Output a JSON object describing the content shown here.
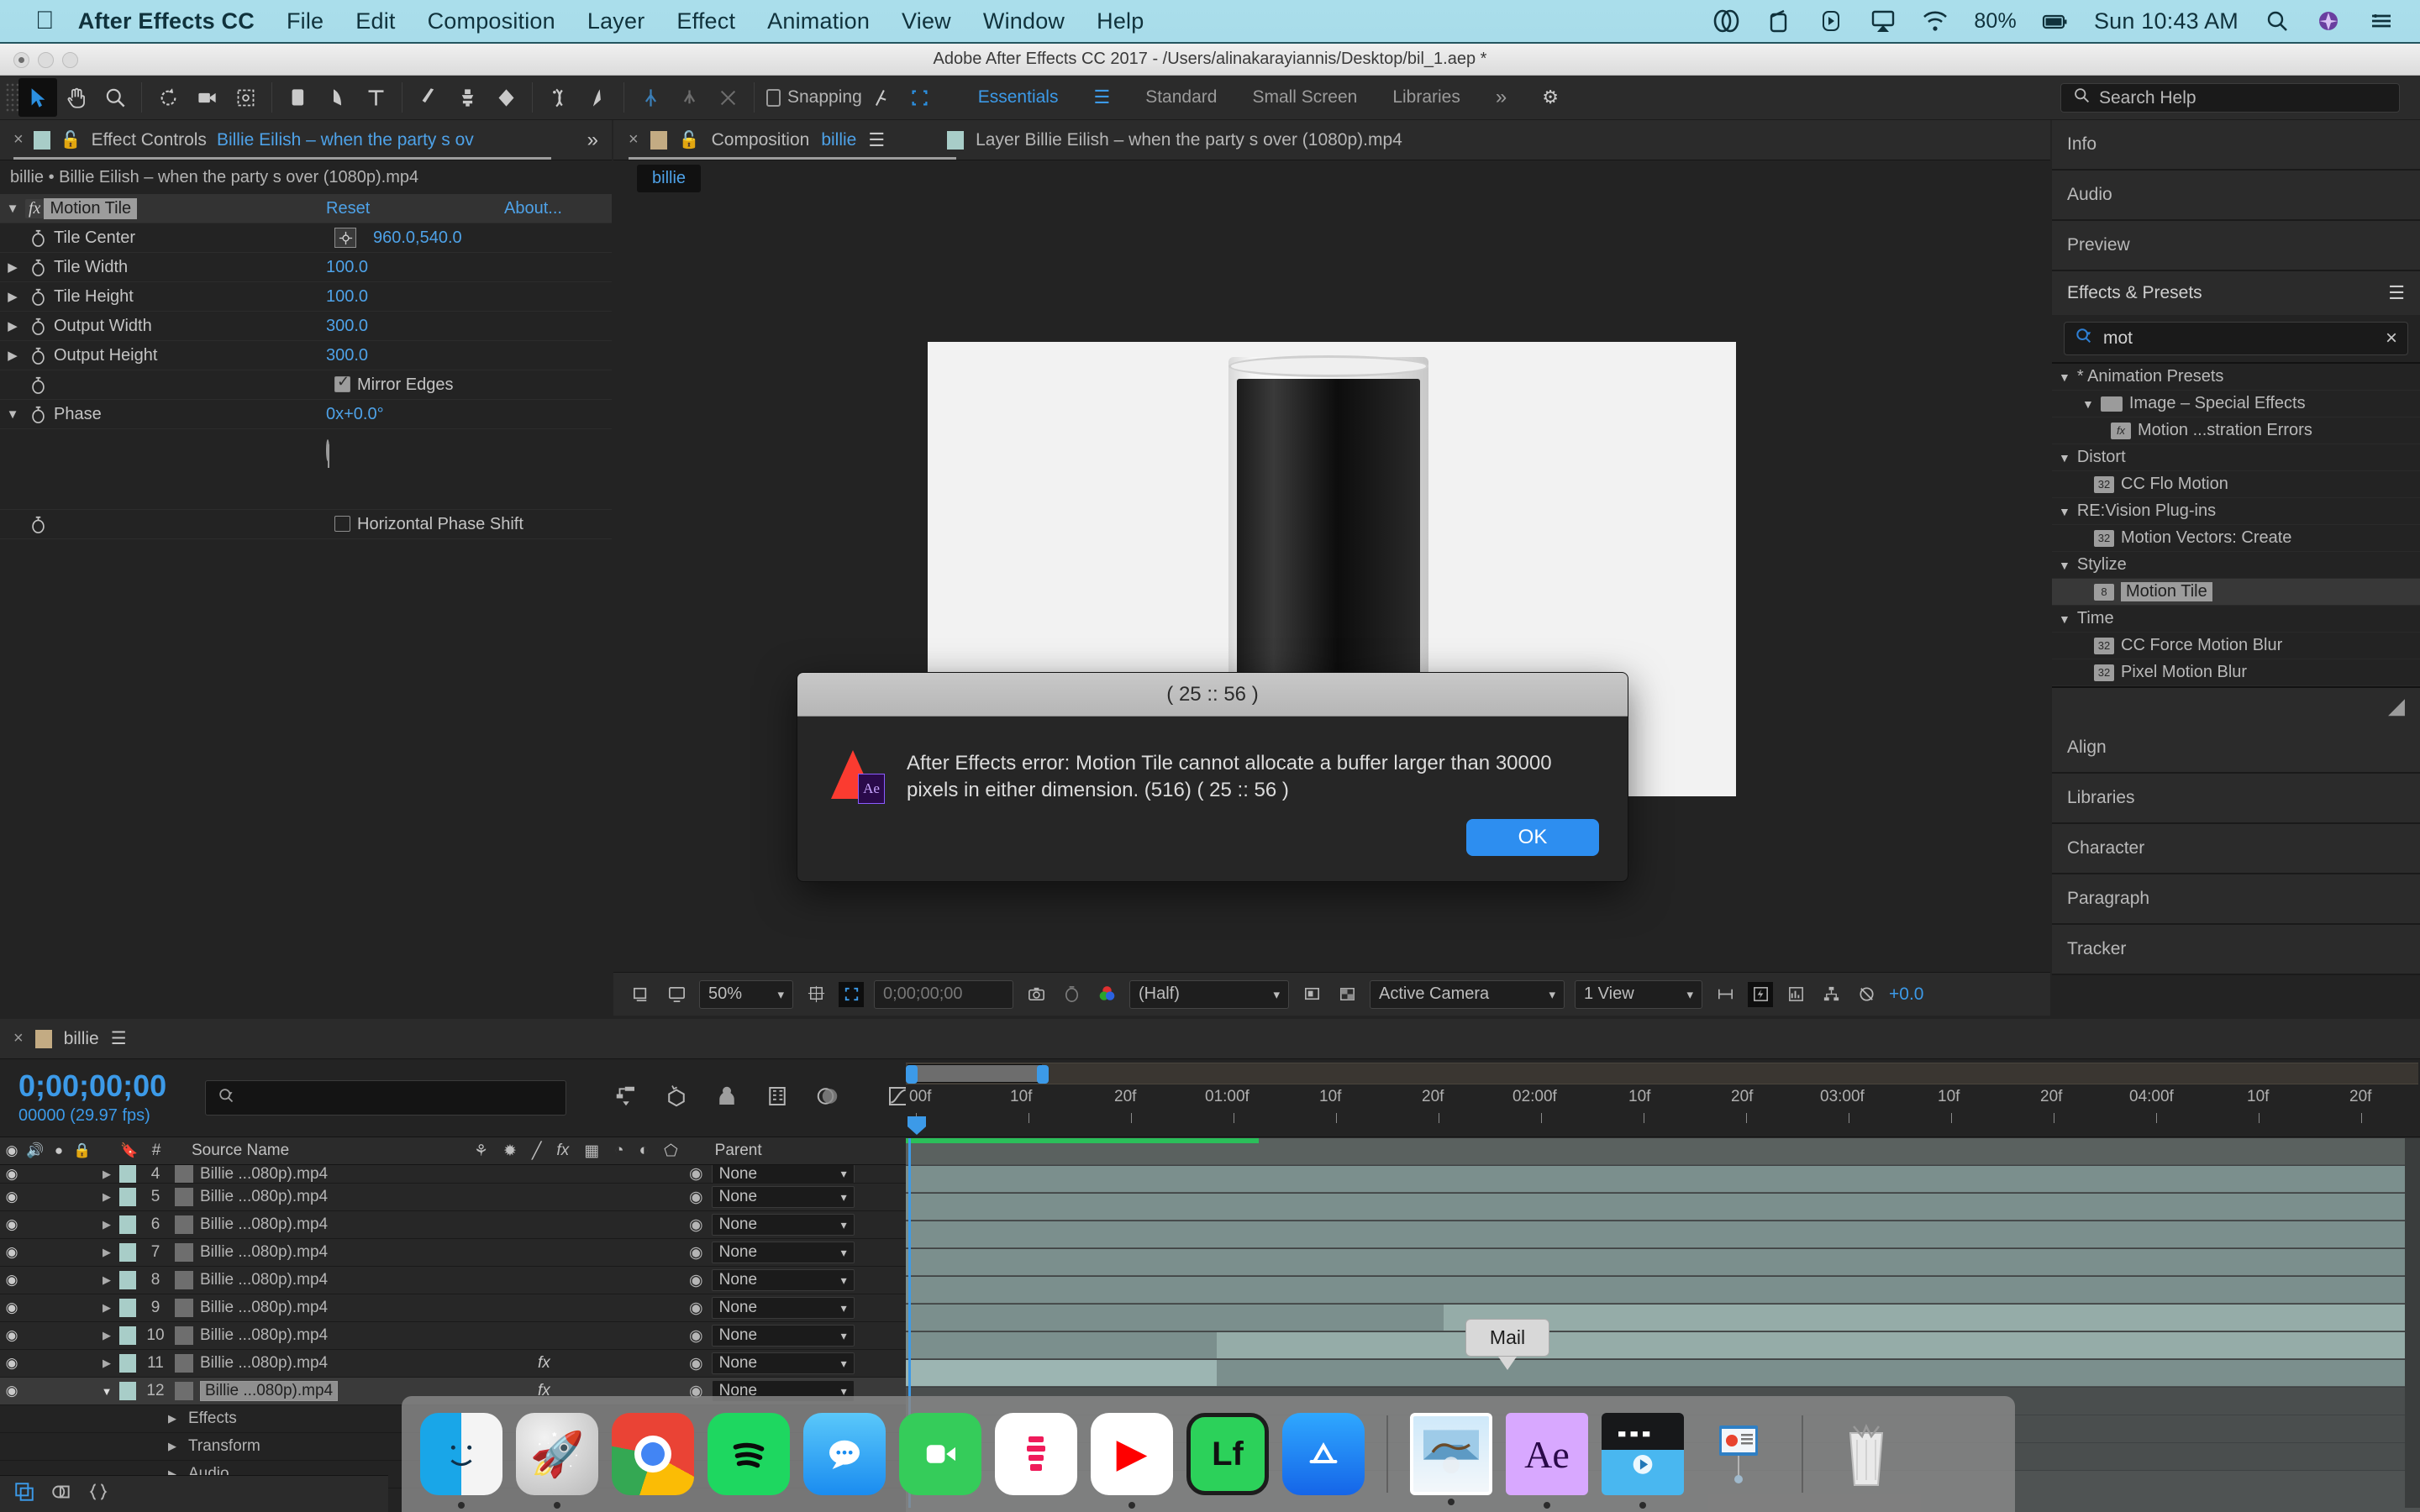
{
  "mac_menu": {
    "apple": "apple-logo",
    "items": [
      "After Effects CC",
      "File",
      "Edit",
      "Composition",
      "Layer",
      "Effect",
      "Animation",
      "View",
      "Window",
      "Help"
    ],
    "status": {
      "battery": "80%",
      "clock": "Sun 10:43 AM",
      "icons": [
        "creative-cloud-icon",
        "screen-record-icon",
        "quicktime-icon",
        "airplay-icon",
        "wifi-icon",
        "battery-icon",
        "spotlight-icon",
        "siri-icon",
        "control-center-icon"
      ]
    }
  },
  "window": {
    "title": "Adobe After Effects CC 2017 - /Users/alinakarayiannis/Desktop/bil_1.aep *"
  },
  "toolbar": {
    "tools": [
      "selection-tool",
      "hand-tool",
      "zoom-tool",
      "rotation-tool",
      "camera-tool",
      "pan-behind-tool",
      "rect-mask-tool",
      "pen-tool",
      "text-tool",
      "brush-tool",
      "clone-stamp-tool",
      "eraser-tool",
      "roto-brush-tool",
      "puppet-pin-tool"
    ],
    "rigid_tools": [
      "puppet-starch-tool",
      "puppet-overlap-tool",
      "puppet-bend-tool"
    ],
    "snapping_label": "Snapping",
    "workspaces": [
      "Essentials",
      "Standard",
      "Small Screen",
      "Libraries"
    ],
    "active_workspace": "Essentials",
    "overflow": "»",
    "search_help_placeholder": "Search Help"
  },
  "effect_controls": {
    "tab_prefix": "Effect Controls",
    "tab_target": "Billie Eilish – when the party s ov",
    "subheader": "billie • Billie Eilish – when the party s over (1080p).mp4",
    "effect_name": "Motion Tile",
    "reset_label": "Reset",
    "about_label": "About...",
    "properties": [
      {
        "name": "Tile Center",
        "value": "960.0,540.0",
        "type": "point"
      },
      {
        "name": "Tile Width",
        "value": "100.0",
        "type": "slider"
      },
      {
        "name": "Tile Height",
        "value": "100.0",
        "type": "slider"
      },
      {
        "name": "Output Width",
        "value": "300.0",
        "type": "slider"
      },
      {
        "name": "Output Height",
        "value": "300.0",
        "type": "slider"
      },
      {
        "name": "Mirror Edges",
        "value": "",
        "type": "checkbox_on"
      },
      {
        "name": "Phase",
        "value": "0x+0.0°",
        "type": "angle"
      },
      {
        "name": "Horizontal Phase Shift",
        "value": "",
        "type": "checkbox_off"
      }
    ]
  },
  "composition": {
    "tab_prefix": "Composition",
    "tab_name": "billie",
    "layer_tab": "Layer Billie Eilish – when the party s over (1080p).mp4",
    "breadcrumb_tab": "billie",
    "bottom_bar": {
      "magnification": "50%",
      "time": "0;00;00;00",
      "resolution": "(Half)",
      "camera": "Active Camera",
      "views": "1 View",
      "exposure": "+0.0"
    }
  },
  "right_panels": {
    "collapsed": [
      "Info",
      "Audio",
      "Preview"
    ],
    "effects_presets": {
      "title": "Effects & Presets",
      "search_value": "mot",
      "tree": [
        {
          "label": "* Animation Presets",
          "depth": 0,
          "type": "group",
          "expanded": true
        },
        {
          "label": "Image – Special Effects",
          "depth": 1,
          "type": "folder",
          "expanded": true
        },
        {
          "label": "Motion ...stration Errors",
          "depth": 2,
          "type": "preset"
        },
        {
          "label": "Distort",
          "depth": 0,
          "type": "group",
          "expanded": true
        },
        {
          "label": "CC Flo Motion",
          "depth": 1,
          "type": "effect32"
        },
        {
          "label": "RE:Vision Plug-ins",
          "depth": 0,
          "type": "group",
          "expanded": true
        },
        {
          "label": "Motion Vectors: Create",
          "depth": 1,
          "type": "effect32"
        },
        {
          "label": "Stylize",
          "depth": 0,
          "type": "group",
          "expanded": true
        },
        {
          "label": "Motion Tile",
          "depth": 1,
          "type": "effect8",
          "selected": true
        },
        {
          "label": "Time",
          "depth": 0,
          "type": "group",
          "expanded": true
        },
        {
          "label": "CC Force Motion Blur",
          "depth": 1,
          "type": "effect32"
        },
        {
          "label": "Pixel Motion Blur",
          "depth": 1,
          "type": "effect32"
        }
      ]
    },
    "more": [
      "Align",
      "Libraries",
      "Character",
      "Paragraph",
      "Tracker"
    ]
  },
  "timeline": {
    "comp_tab": "billie",
    "current_time": "0;00;00;00",
    "frame_info": "00000 (29.97 fps)",
    "search_placeholder": "",
    "columns": [
      "#",
      "Source Name",
      "Parent"
    ],
    "layers": [
      {
        "num": "4",
        "name": "Billie ...080p).mp4",
        "parent": "None",
        "fx": false,
        "selected": false,
        "expanded": false
      },
      {
        "num": "5",
        "name": "Billie ...080p).mp4",
        "parent": "None",
        "fx": false,
        "selected": false,
        "expanded": false
      },
      {
        "num": "6",
        "name": "Billie ...080p).mp4",
        "parent": "None",
        "fx": false,
        "selected": false,
        "expanded": false
      },
      {
        "num": "7",
        "name": "Billie ...080p).mp4",
        "parent": "None",
        "fx": false,
        "selected": false,
        "expanded": false
      },
      {
        "num": "8",
        "name": "Billie ...080p).mp4",
        "parent": "None",
        "fx": false,
        "selected": false,
        "expanded": false
      },
      {
        "num": "9",
        "name": "Billie ...080p).mp4",
        "parent": "None",
        "fx": false,
        "selected": false,
        "expanded": false
      },
      {
        "num": "10",
        "name": "Billie ...080p).mp4",
        "parent": "None",
        "fx": false,
        "selected": false,
        "expanded": false
      },
      {
        "num": "11",
        "name": "Billie ...080p).mp4",
        "parent": "None",
        "fx": true,
        "selected": false,
        "expanded": false
      },
      {
        "num": "12",
        "name": "Billie ...080p).mp4",
        "parent": "None",
        "fx": true,
        "selected": true,
        "expanded": true
      }
    ],
    "sublayers": [
      "Effects",
      "Transform",
      "Audio"
    ],
    "ruler_labels": [
      "00f",
      "10f",
      "20f",
      "01:00f",
      "10f",
      "20f",
      "02:00f",
      "10f",
      "20f",
      "03:00f",
      "10f",
      "20f",
      "04:00f",
      "10f",
      "20f"
    ]
  },
  "dialog": {
    "title": "( 25 :: 56 )",
    "message": "After Effects error: Motion Tile cannot allocate a buffer larger than 30000 pixels in either dimension.  (516) ( 25 :: 56 )",
    "ok_label": "OK",
    "icon": "ae-warning-icon"
  },
  "dock": {
    "tooltip": "Mail",
    "items": [
      {
        "name": "finder",
        "color1": "#19a6e8",
        "color2": "#f4f4f4",
        "glyph": ""
      },
      {
        "name": "launchpad",
        "color1": "#d6d6d6",
        "color2": "#b5b5b5",
        "glyph": "🚀"
      },
      {
        "name": "google-chrome",
        "color1": "#ea4335",
        "color2": "#4285f4",
        "glyph": ""
      },
      {
        "name": "spotify",
        "color1": "#1ed760",
        "color2": "#0f0f0f",
        "glyph": ""
      },
      {
        "name": "messages",
        "color1": "#40b3ff",
        "color2": "#ffffff",
        "glyph": "💬"
      },
      {
        "name": "facetime",
        "color1": "#35cc5a",
        "color2": "#ffffff",
        "glyph": "📹"
      },
      {
        "name": "youtube-music",
        "color1": "#ffffff",
        "color2": "#ef1b5a",
        "glyph": ""
      },
      {
        "name": "youtube",
        "color1": "#ffffff",
        "color2": "#ff0000",
        "glyph": "▶"
      },
      {
        "name": "line-app",
        "color1": "#2cd15a",
        "color2": "#111111",
        "glyph": "Lf"
      },
      {
        "name": "app-store",
        "color1": "#1b8cf5",
        "color2": "#ffffff",
        "glyph": "Ⓐ"
      },
      {
        "name": "mail",
        "color1": "#b8dff5",
        "color2": "#ffffff",
        "glyph": ""
      },
      {
        "name": "after-effects",
        "color1": "#2a0a4a",
        "color2": "#d8a8ff",
        "glyph": "Ae"
      },
      {
        "name": "quicktime-player",
        "color1": "#1f1f1f",
        "color2": "#49b7f0",
        "glyph": ""
      },
      {
        "name": "keynote",
        "color1": "#3a8bd8",
        "color2": "#ffffff",
        "glyph": ""
      },
      {
        "name": "trash",
        "color1": "#dddddd",
        "color2": "#bbbbbb",
        "glyph": ""
      }
    ]
  }
}
